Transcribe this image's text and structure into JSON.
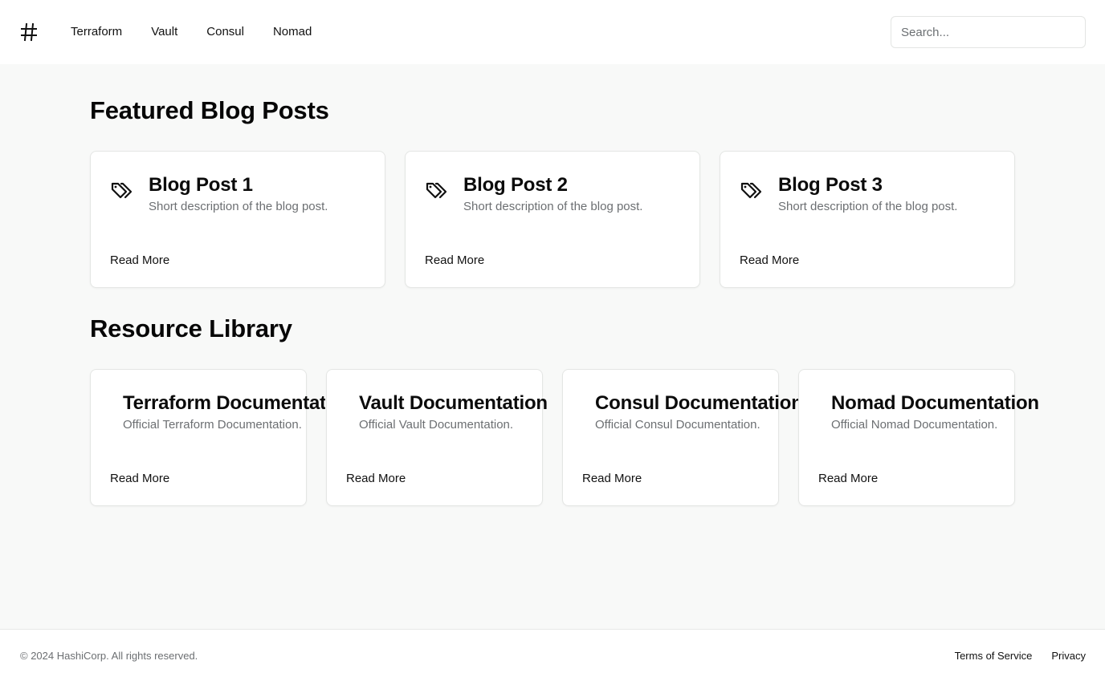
{
  "header": {
    "logo": "#",
    "nav": [
      "Terraform",
      "Vault",
      "Consul",
      "Nomad"
    ],
    "search_placeholder": "Search..."
  },
  "blog": {
    "title": "Featured Blog Posts",
    "posts": [
      {
        "title": "Blog Post 1",
        "description": "Short description of the blog post.",
        "link": "Read More",
        "icon": "tags-icon"
      },
      {
        "title": "Blog Post 2",
        "description": "Short description of the blog post.",
        "link": "Read More",
        "icon": "tags-icon"
      },
      {
        "title": "Blog Post 3",
        "description": "Short description of the blog post.",
        "link": "Read More",
        "icon": "tags-icon"
      }
    ]
  },
  "resources": {
    "title": "Resource Library",
    "items": [
      {
        "title": "Terraform Documentation",
        "description": "Official Terraform Documentation.",
        "link": "Read More"
      },
      {
        "title": "Vault Documentation",
        "description": "Official Vault Documentation.",
        "link": "Read More"
      },
      {
        "title": "Consul Documentation",
        "description": "Official Consul Documentation.",
        "link": "Read More"
      },
      {
        "title": "Nomad Documentation",
        "description": "Official Nomad Documentation.",
        "link": "Read More"
      }
    ]
  },
  "footer": {
    "copyright": "© 2024 HashiCorp. All rights reserved.",
    "links": [
      "Terms of Service",
      "Privacy"
    ]
  }
}
